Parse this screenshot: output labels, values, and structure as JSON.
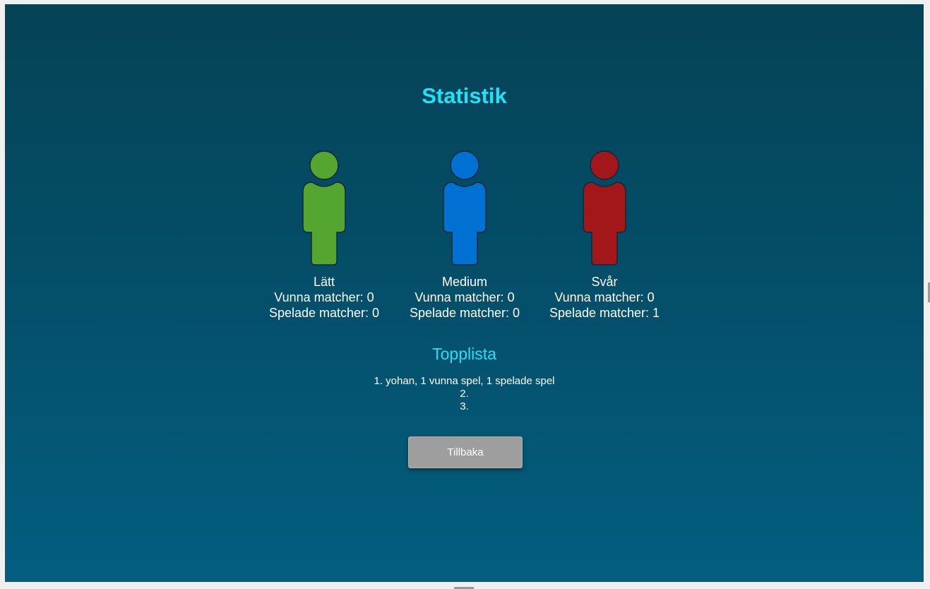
{
  "title": "Statistik",
  "players": [
    {
      "level": "Lätt",
      "won": "Vunna matcher: 0",
      "played": "Spelade matcher: 0",
      "color": "#55a630",
      "icon": "person-icon"
    },
    {
      "level": "Medium",
      "won": "Vunna matcher: 0",
      "played": "Spelade matcher: 0",
      "color": "#0070d2",
      "icon": "person-icon"
    },
    {
      "level": "Svår",
      "won": "Vunna matcher: 0",
      "played": "Spelade matcher: 1",
      "color": "#a3161a",
      "icon": "person-icon"
    }
  ],
  "toplist": {
    "title": "Topplista",
    "entries": [
      "1. yohan, 1 vunna spel, 1 spelade spel",
      "2.",
      "3."
    ]
  },
  "back_button": {
    "label": "Tillbaka"
  },
  "colors": {
    "accent": "#22e0f5",
    "button": "#9e9e9e"
  }
}
